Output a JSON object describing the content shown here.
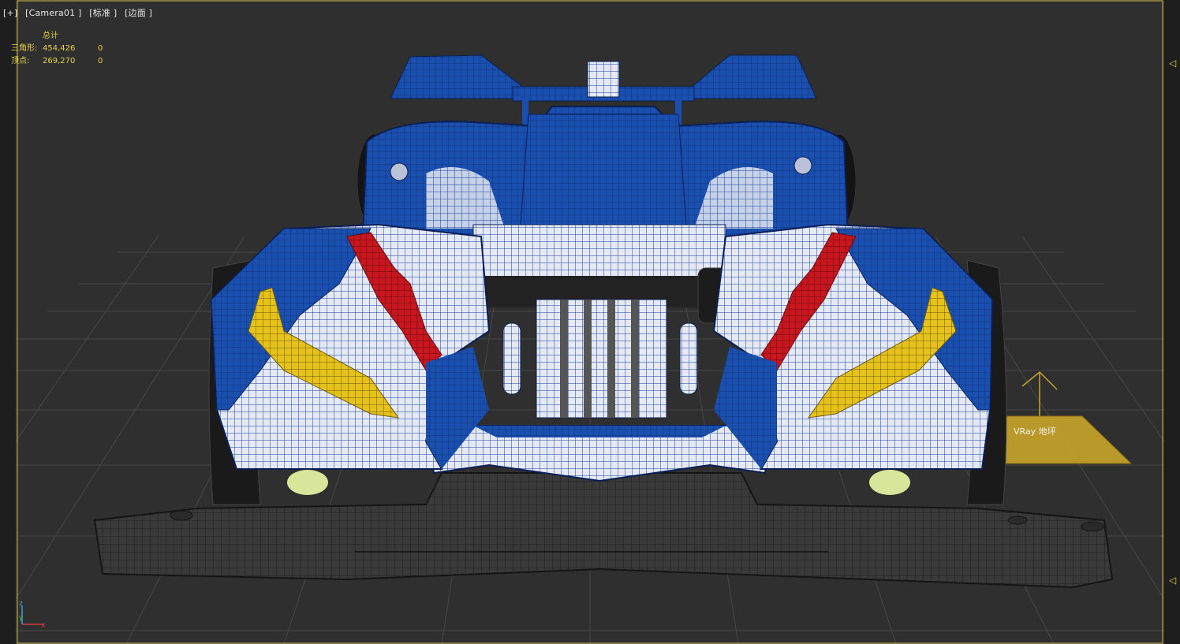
{
  "viewport": {
    "label_parts": [
      "[+]",
      "[Camera01 ]",
      "[标准 ]",
      "[边面 ]"
    ]
  },
  "stats": {
    "header": "总计",
    "rows": [
      {
        "label": "三角形:",
        "total": "454,426",
        "selected": "0"
      },
      {
        "label": "顶点:",
        "total": "269,270",
        "selected": "0"
      }
    ]
  },
  "scene": {
    "light_label": "VRay 地坪",
    "object_name": "car-wireframe-model",
    "colors": {
      "background": "#2f2f2f",
      "grid": "#4a4a4a",
      "body_blue": "#1a4fb0",
      "wire_blue": "#0e2f7a",
      "accent_red": "#c8161e",
      "accent_yellow": "#e6c21a",
      "chassis": "#3a3a3a",
      "frame_yellow": "#d4c04a",
      "light_gizmo": "#c9a52a"
    }
  },
  "axis": {
    "x": "x",
    "y": "y",
    "z": "z"
  },
  "handles": [
    "◁",
    "◁"
  ]
}
